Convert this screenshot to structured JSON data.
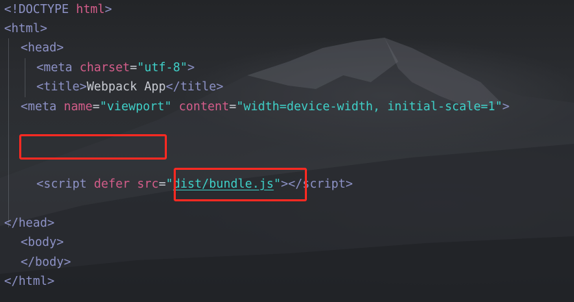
{
  "editor": {
    "lines": [
      [
        "<",
        "!DOCTYPE",
        " ",
        "html",
        ">"
      ],
      [
        "<",
        "html",
        ">"
      ],
      [
        "<",
        "head",
        ">"
      ],
      [
        "<",
        "meta",
        " ",
        "charset",
        "=",
        "\"utf-8\"",
        ">"
      ],
      [
        "<",
        "title",
        ">",
        "Webpack App",
        "</",
        "title",
        ">"
      ],
      [
        "<",
        "meta",
        " ",
        "name",
        "=",
        "\"viewport\"",
        " ",
        "content",
        "=",
        "\"width=device-width, initial-scale=1\"",
        ">"
      ],
      [],
      [],
      [
        "<",
        "script",
        " ",
        "defer",
        " ",
        "src",
        "=",
        "\"",
        "dist/bundle.js",
        "\"",
        ">",
        "</",
        "script",
        ">"
      ],
      [],
      [
        "</",
        "head",
        ">"
      ],
      [
        "<",
        "body",
        ">"
      ],
      [
        "</",
        "body",
        ">"
      ],
      [
        "</",
        "html",
        ">"
      ]
    ]
  },
  "colors": {
    "tag": "#8d92c6",
    "attribute": "#d45d8a",
    "string": "#3fd0c8",
    "text": "#c9ccd3",
    "highlight": "#ff2a22"
  }
}
